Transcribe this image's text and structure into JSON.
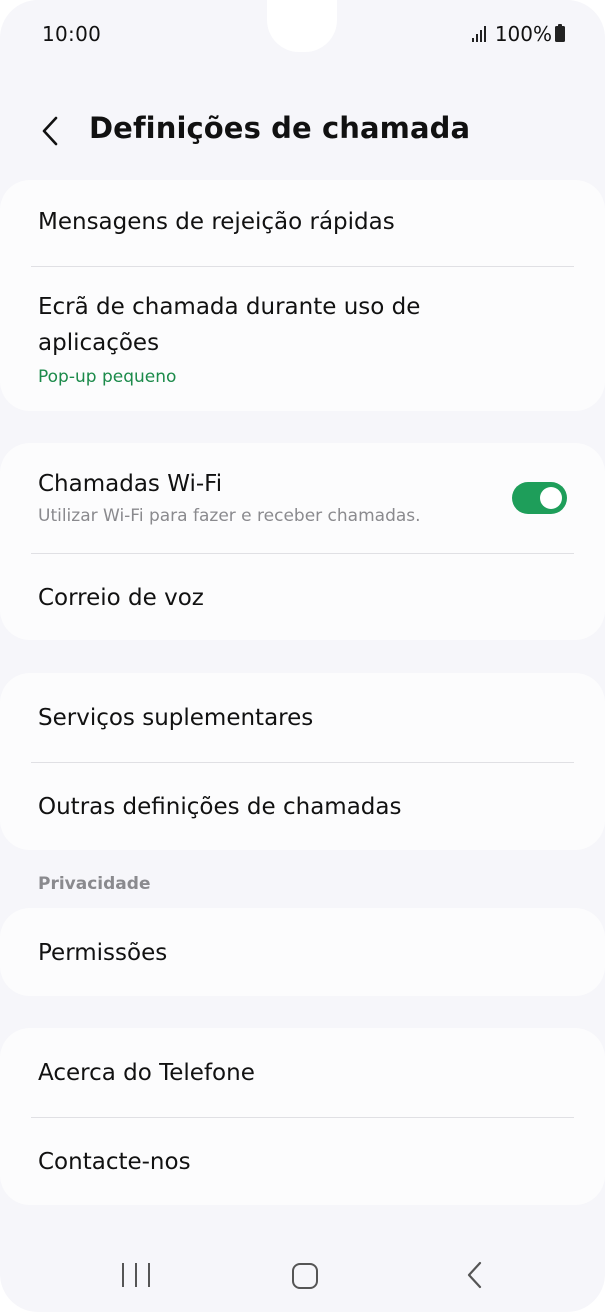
{
  "status_bar": {
    "time": "10:00",
    "battery": "100%"
  },
  "header": {
    "title": "Definições de chamada"
  },
  "cards": {
    "messages": {
      "quick_decline": "Mensagens de rejeição rápidas",
      "call_screen_line1": "Ecrã de chamada durante uso de",
      "call_screen_line2": "aplicações",
      "call_screen_value": "Pop-up pequeno"
    },
    "wifi": {
      "wifi_calls": "Chamadas Wi-Fi",
      "wifi_calls_desc": "Utilizar Wi-Fi para fazer e receber chamadas.",
      "wifi_enabled": true,
      "voicemail": "Correio de voz"
    },
    "services": {
      "supplementary": "Serviços suplementares",
      "other_settings": "Outras definições de chamadas"
    },
    "privacy": {
      "section_label": "Privacidade",
      "permissions": "Permissões"
    },
    "about": {
      "about_phone": "Acerca do Telefone",
      "contact_us": "Contacte-nos"
    }
  },
  "colors": {
    "accent_green": "#1e9e5a",
    "subtitle_green": "#1b8a4a",
    "background": "#f6f6fa",
    "card": "#fcfcfd"
  },
  "icons": {
    "back": "chevron-left-icon",
    "signal": "signal-icon",
    "battery": "battery-icon",
    "nav_recents": "recents-icon",
    "nav_home": "home-icon",
    "nav_back": "back-nav-icon"
  }
}
